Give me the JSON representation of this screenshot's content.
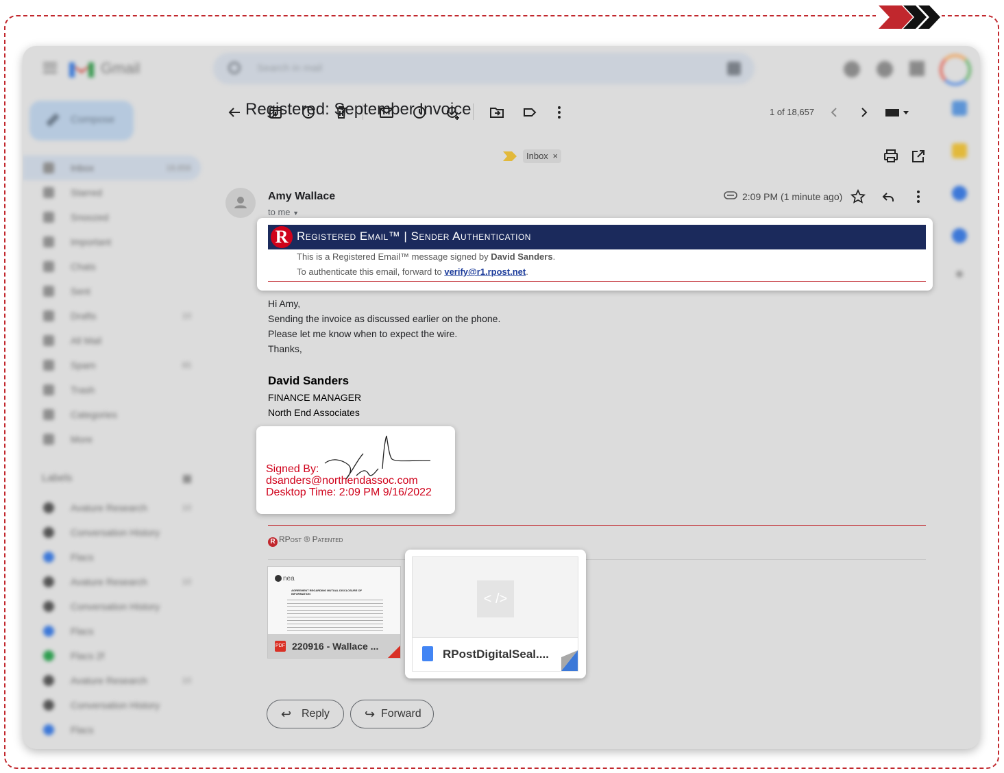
{
  "app": {
    "name": "Gmail"
  },
  "search": {
    "placeholder": "Search in mail"
  },
  "compose": {
    "label": "Compose"
  },
  "nav": [
    {
      "label": "Inbox",
      "count": "18,656",
      "active": true
    },
    {
      "label": "Starred",
      "count": ""
    },
    {
      "label": "Snoozed",
      "count": ""
    },
    {
      "label": "Important",
      "count": ""
    },
    {
      "label": "Chats",
      "count": ""
    },
    {
      "label": "Sent",
      "count": ""
    },
    {
      "label": "Drafts",
      "count": "10"
    },
    {
      "label": "All Mail",
      "count": ""
    },
    {
      "label": "Spam",
      "count": "65"
    },
    {
      "label": "Trash",
      "count": ""
    },
    {
      "label": "Categories",
      "count": ""
    },
    {
      "label": "More",
      "count": ""
    }
  ],
  "labels": {
    "title": "Labels",
    "items": [
      {
        "label": "Avature Research",
        "count": "10"
      },
      {
        "label": "Conversation History",
        "count": ""
      },
      {
        "label": "Flacs",
        "count": ""
      },
      {
        "label": "Avature Research",
        "count": "10"
      },
      {
        "label": "Conversation History",
        "count": ""
      },
      {
        "label": "Flacs",
        "count": ""
      },
      {
        "label": "Flacs 2f",
        "count": ""
      },
      {
        "label": "Avature Research",
        "count": "10"
      },
      {
        "label": "Conversation History",
        "count": ""
      },
      {
        "label": "Flacs",
        "count": ""
      }
    ]
  },
  "toolbar": {
    "pager": "1 of 18,657"
  },
  "message": {
    "subject": "Registered: September Invoice",
    "label_chip": "Inbox",
    "sender": "Amy Wallace",
    "recipient": "to me",
    "time": "2:09 PM (1 minute ago)"
  },
  "banner": {
    "title": "Registered Email™ | Sender Authentication",
    "line1_prefix": "This is a Registered Email™ message signed by ",
    "line1_name": "David Sanders",
    "line1_suffix": ".",
    "line2_prefix": "To authenticate this email, forward to ",
    "line2_link": "verify@r1.rpost.net",
    "line2_suffix": "."
  },
  "body": {
    "lines": [
      "Hi Amy,",
      "Sending the invoice as discussed earlier on the phone.",
      "Please let me know when to expect the wire.",
      "Thanks,"
    ],
    "sig_name": "David Sanders",
    "sig_title": "FINANCE MANAGER",
    "sig_org": "North End Associates"
  },
  "seal": {
    "line1": "Signed By:",
    "line2": "dsanders@northendassoc.com",
    "line3": "Desktop Time: 2:09 PM 9/16/2022"
  },
  "rpost": {
    "text": "RPost ® Patented"
  },
  "attachments": [
    {
      "name": "220916 - Wallace ...",
      "type": "PDF",
      "doc_title": "AGREEMENT REGARDING MUTUAL DISCLOSURE OF INFORMATION",
      "doc_brand": "nea"
    },
    {
      "name": "RPostDigitalSeal....",
      "type": "code",
      "preview": "< />"
    }
  ],
  "actions": {
    "reply": "Reply",
    "forward": "Forward"
  },
  "colors": {
    "accent_red": "#c1272d",
    "banner_navy": "#1b2a5c",
    "link_blue": "#1a3a9a"
  }
}
